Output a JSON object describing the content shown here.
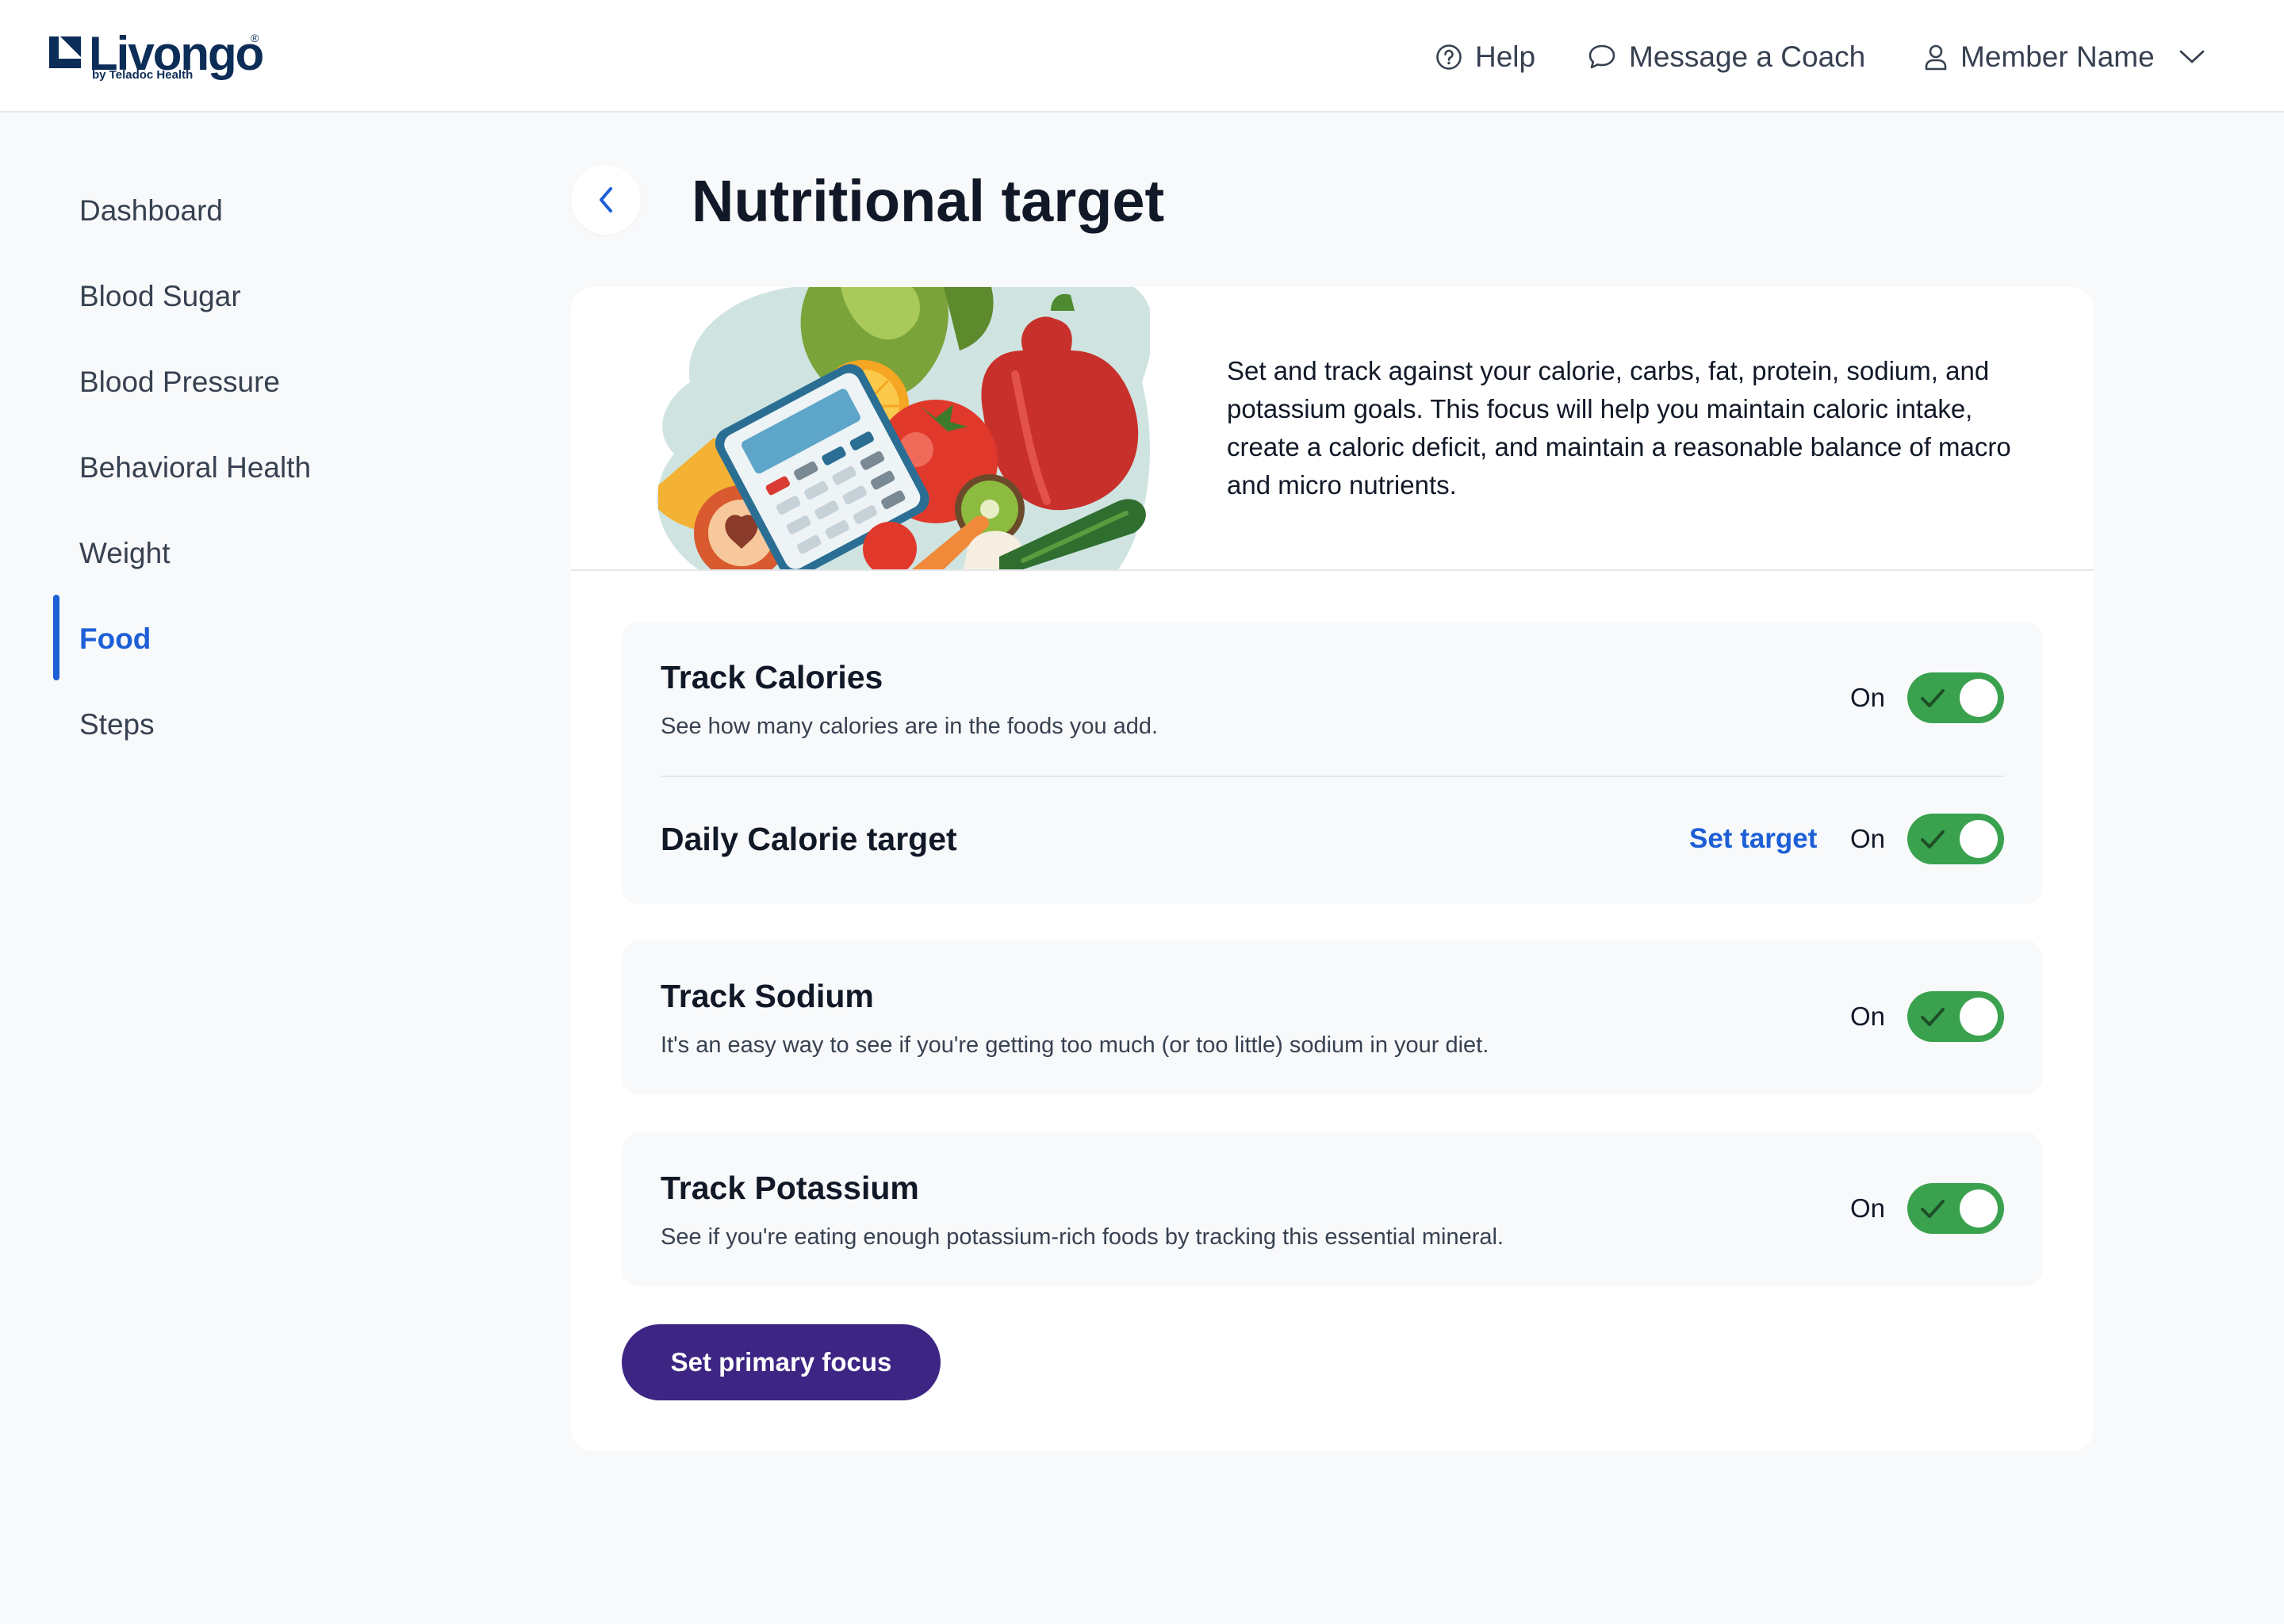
{
  "header": {
    "logo_text": "Livongo",
    "logo_registered": "®",
    "logo_subtext": "by Teladoc Health",
    "help_label": "Help",
    "coach_label": "Message a Coach",
    "member_label": "Member Name",
    "icons": [
      "help-circle-icon",
      "chat-bubble-icon",
      "user-icon",
      "chevron-down-icon"
    ]
  },
  "sidebar": {
    "items": [
      {
        "label": "Dashboard"
      },
      {
        "label": "Blood Sugar"
      },
      {
        "label": "Blood Pressure"
      },
      {
        "label": "Behavioral Health"
      },
      {
        "label": "Weight"
      },
      {
        "label": "Food",
        "active": true
      },
      {
        "label": "Steps"
      }
    ]
  },
  "page": {
    "title": "Nutritional target",
    "description": "Set and track against your calorie, carbs, fat, protein, sodium, and potassium goals. This focus will help you maintain caloric intake, create a caloric deficit, and maintain a reasonable balance of macro and micro nutrients."
  },
  "settings": {
    "calories": {
      "title": "Track Calories",
      "description": "See how many calories are in the foods you add.",
      "state": "On"
    },
    "daily_target": {
      "title": "Daily Calorie target",
      "link": "Set target",
      "state": "On"
    },
    "sodium": {
      "title": "Track Sodium",
      "description": "It's an easy way to see if you're getting too much (or too little) sodium in your diet.",
      "state": "On"
    },
    "potassium": {
      "title": "Track Potassium",
      "description": "See if you're eating enough potassium-rich foods by tracking this essential mineral.",
      "state": "On"
    }
  },
  "primary_button": "Set primary focus",
  "colors": {
    "accent_blue": "#1d5fd6",
    "toggle_green": "#3aa24f",
    "primary_purple": "#3d2584",
    "brand_navy": "#0c2d57",
    "background": "#f8f9fa"
  }
}
